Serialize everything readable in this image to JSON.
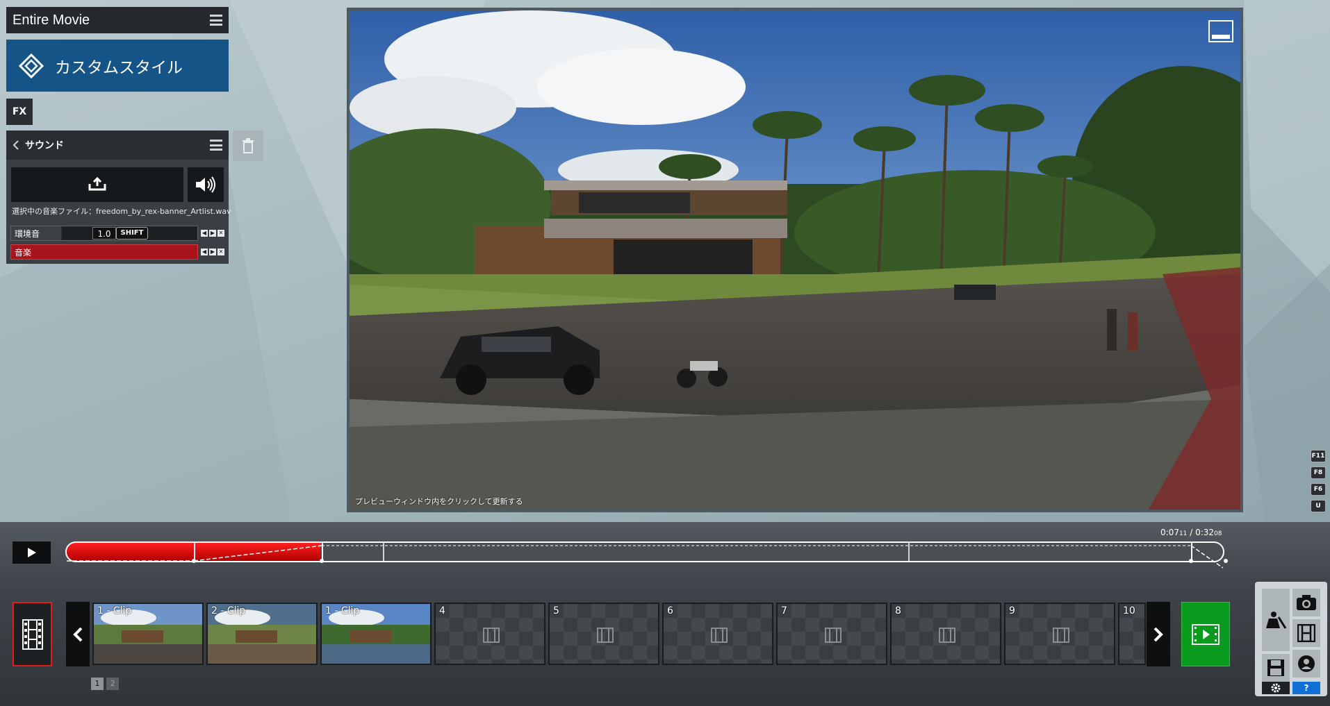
{
  "header": {
    "title": "Entire Movie"
  },
  "style_button": {
    "label": "カスタムスタイル"
  },
  "fx_button": {
    "label": "FX"
  },
  "sound": {
    "title": "サウンド",
    "selected_file_text": "選択中の音楽ファイル：freedom_by_rex-banner_Artlist.wav",
    "tracks": [
      {
        "label": "環境音",
        "value": "1.0",
        "modifier": "SHIFT"
      },
      {
        "label": "音楽"
      }
    ]
  },
  "preview": {
    "caption": "プレビューウィンドウ内をクリックして更新する"
  },
  "hotkeys": [
    "F11",
    "F8",
    "F6",
    "U"
  ],
  "timeline": {
    "current": "0:07",
    "current_frames": "11",
    "separator": " / ",
    "total": "0:32",
    "total_frames": "08",
    "progress_fraction": 0.22
  },
  "clips": [
    {
      "label": "1 - Clip",
      "filled": true
    },
    {
      "label": "2 - Clip",
      "filled": true
    },
    {
      "label": "1 - Clip",
      "filled": true
    },
    {
      "label": "4",
      "filled": false
    },
    {
      "label": "5",
      "filled": false
    },
    {
      "label": "6",
      "filled": false
    },
    {
      "label": "7",
      "filled": false
    },
    {
      "label": "8",
      "filled": false
    },
    {
      "label": "9",
      "filled": false
    },
    {
      "label": "10",
      "filled": false
    }
  ],
  "pages": [
    "1",
    "2"
  ],
  "tools": {
    "help_label": "?"
  },
  "colors": {
    "accent_red": "#e31b1b",
    "style_blue": "#155487",
    "add_green": "#0a9a1d"
  }
}
